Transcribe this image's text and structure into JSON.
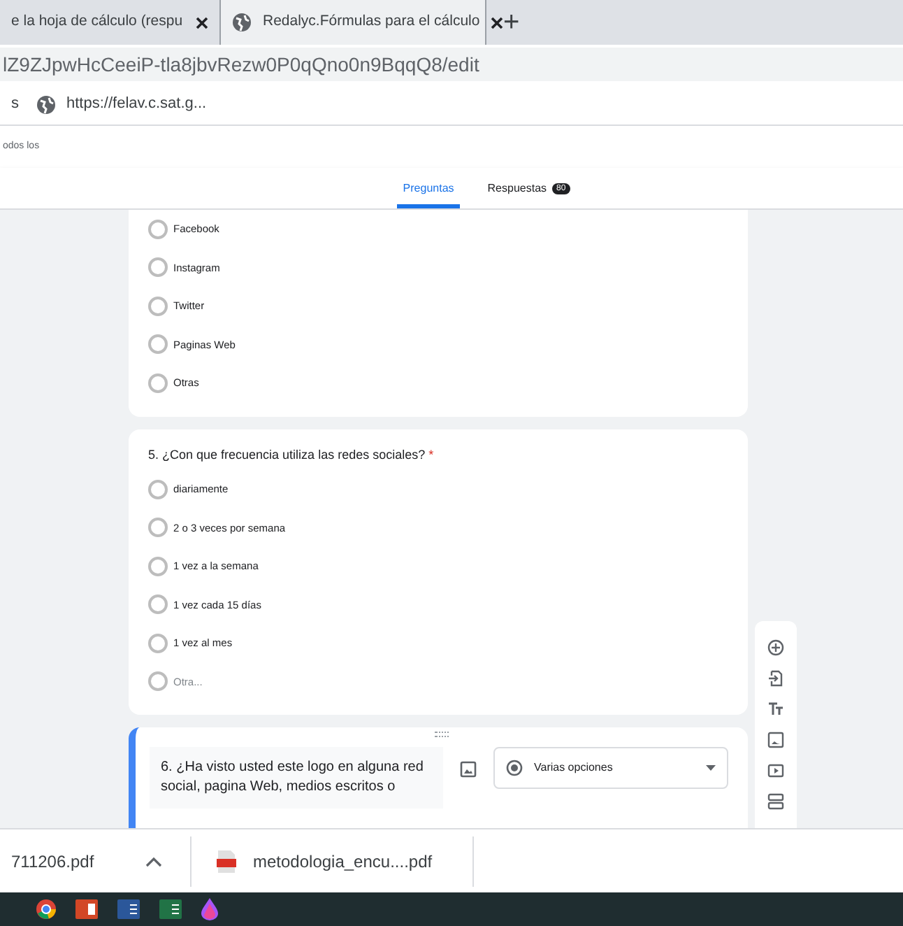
{
  "browser_tabs": [
    {
      "title": "e la hoja de cálculo (respu",
      "selected": false,
      "has_icon": false
    },
    {
      "title": "Redalyc.Fórmulas para el cálculo",
      "selected": true,
      "has_icon": true
    }
  ],
  "new_tab": "+",
  "address": "lZ9ZJpwHcCeeiP-tla8jbvRezw0P0qQno0n9BqqQ8/edit",
  "bookmarks": [
    {
      "label": "s",
      "has_icon": false
    },
    {
      "label": "https://felav.c.sat.g...",
      "has_icon": true
    }
  ],
  "page_text": "odos los",
  "form_tabs": [
    {
      "label": "Preguntas",
      "selected": true
    },
    {
      "label": "Respuestas",
      "selected": false,
      "badge": "80"
    }
  ],
  "cards": [
    {
      "options": [
        {
          "label": "Facebook",
          "selected": false
        },
        {
          "label": "Instagram",
          "selected": false
        },
        {
          "label": "Twitter",
          "selected": false
        },
        {
          "label": "Paginas Web",
          "selected": false
        },
        {
          "label": "Otras",
          "selected": false
        }
      ]
    },
    {
      "question": "5. ¿Con que frecuencia utiliza las redes sociales?",
      "required_mark": "*",
      "options": [
        {
          "label": "diariamente",
          "selected": false
        },
        {
          "label": "2 o 3 veces por semana",
          "selected": false
        },
        {
          "label": "1 vez a la semana",
          "selected": false
        },
        {
          "label": "1 vez cada 15 días",
          "selected": false
        },
        {
          "label": "1 vez al mes",
          "selected": false
        },
        {
          "label": "Otra...",
          "selected": false,
          "kind": "other"
        }
      ]
    }
  ],
  "active_card": {
    "question": "6. ¿Ha visto usted este logo en alguna red social, pagina Web, medios escritos o",
    "type": "Varias opciones"
  },
  "downloads": [
    {
      "name": "711206.pdf",
      "has_icon": false
    },
    {
      "name": "metodologia_encu....pdf",
      "has_icon": true
    }
  ]
}
